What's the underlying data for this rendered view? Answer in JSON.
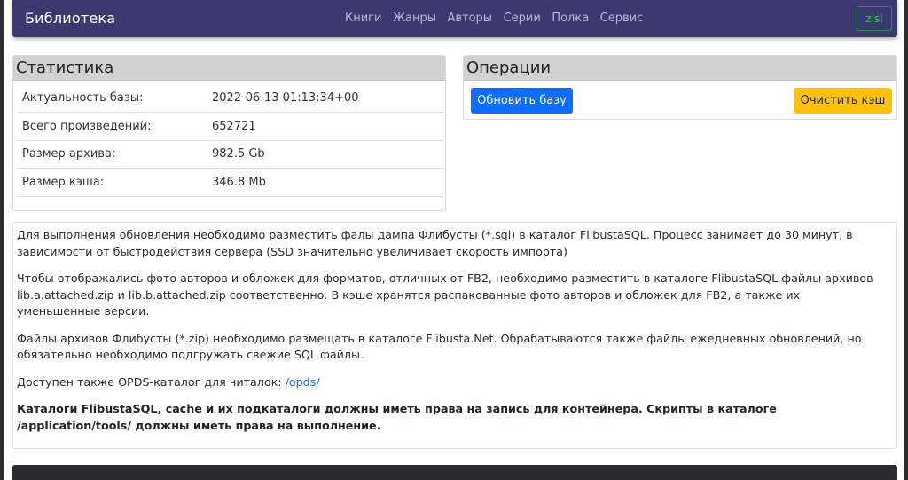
{
  "navbar": {
    "brand": "Библиотека",
    "links": [
      "Книги",
      "Жанры",
      "Авторы",
      "Серии",
      "Полка",
      "Сервис"
    ],
    "user": "zlsl"
  },
  "stats": {
    "title": "Статистика",
    "rows": [
      {
        "label": "Актуальность базы:",
        "value": "2022-06-13 01:13:34+00"
      },
      {
        "label": "Всего произведений:",
        "value": "652721"
      },
      {
        "label": "Размер архива:",
        "value": "982.5 Gb"
      },
      {
        "label": "Размер кэша:",
        "value": "346.8 Mb"
      }
    ]
  },
  "operations": {
    "title": "Операции",
    "update_label": "Обновить базу",
    "clear_label": "Очистить кэш"
  },
  "info": {
    "p1": "Для выполнения обновления необходимо разместить фалы дампа Флибусты (*.sql) в каталог FlibustaSQL. Процесс занимает до 30 минут, в зависимости от быстродействия сервера (SSD значительно увеличивает скорость импорта)",
    "p2": "Чтобы отображались фото авторов и обложек для форматов, отличных от FB2, необходимо разместить в каталоге FlibustaSQL файлы архивов lib.a.attached.zip и lib.b.attached.zip соответственно. В кэше хранятся распакованные фото авторов и обложек для FB2, а также их уменьшенные версии.",
    "p3": "Файлы архивов Флибусты (*.zip) необходимо размещать в каталоге Flibusta.Net. Обрабатываются также файлы ежедневных обновлений, но обязательно необходимо подгружать свежие SQL файлы.",
    "p4_prefix": "Доступен также OPDS-каталог для читалок: ",
    "p4_link": "/opds/",
    "p5": "Каталоги FlibustaSQL, cache и их подкаталоги должны иметь права на запись для контейнера. Скрипты в каталоге /application/tools/ должны иметь права на выполнение."
  },
  "colors": {
    "navbar": "#3b3a6e",
    "primary": "#0d6efd",
    "warning": "#ffc107",
    "link": "#1a66e0"
  }
}
